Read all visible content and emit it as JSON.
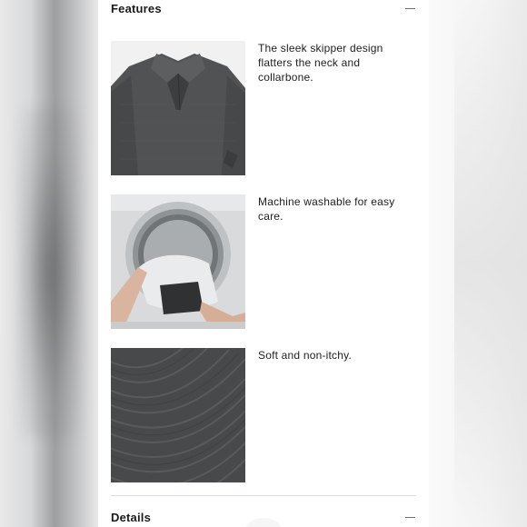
{
  "features_section": {
    "title": "Features",
    "items": [
      {
        "text": "The sleek skipper design flatters the neck and collarbone.",
        "image": "sweater-collar-photo"
      },
      {
        "text": "Machine washable for easy care.",
        "image": "washing-machine-photo"
      },
      {
        "text": "Soft and non-itchy.",
        "image": "knit-fabric-photo"
      }
    ]
  },
  "details_section": {
    "title": "Details"
  },
  "colors": {
    "panel_background": "#ffffff",
    "text": "#1b1b1b",
    "sweater_gray": "#4f5153",
    "divider": "#dcdcdc"
  }
}
